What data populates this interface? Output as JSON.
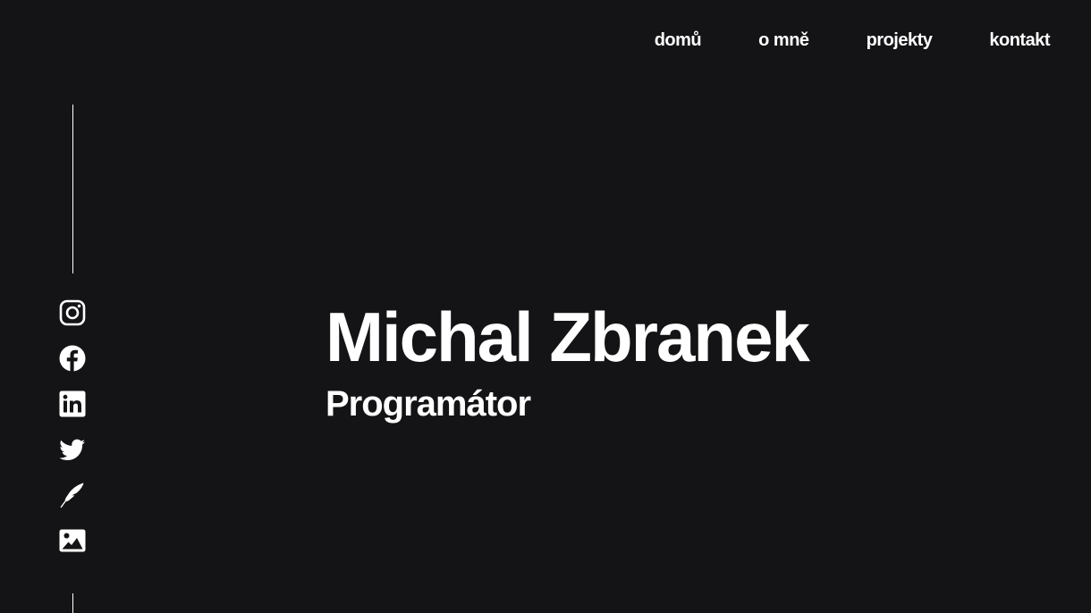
{
  "nav": {
    "items": [
      {
        "label": "domů"
      },
      {
        "label": "o mně"
      },
      {
        "label": "projekty"
      },
      {
        "label": "kontakt"
      }
    ]
  },
  "social": {
    "icons": [
      "instagram-icon",
      "facebook-icon",
      "linkedin-icon",
      "twitter-icon",
      "pen-icon",
      "image-icon"
    ]
  },
  "hero": {
    "name": "Michal Zbranek",
    "role": "Programátor"
  },
  "colors": {
    "background": "#141416",
    "text": "#ffffff"
  }
}
